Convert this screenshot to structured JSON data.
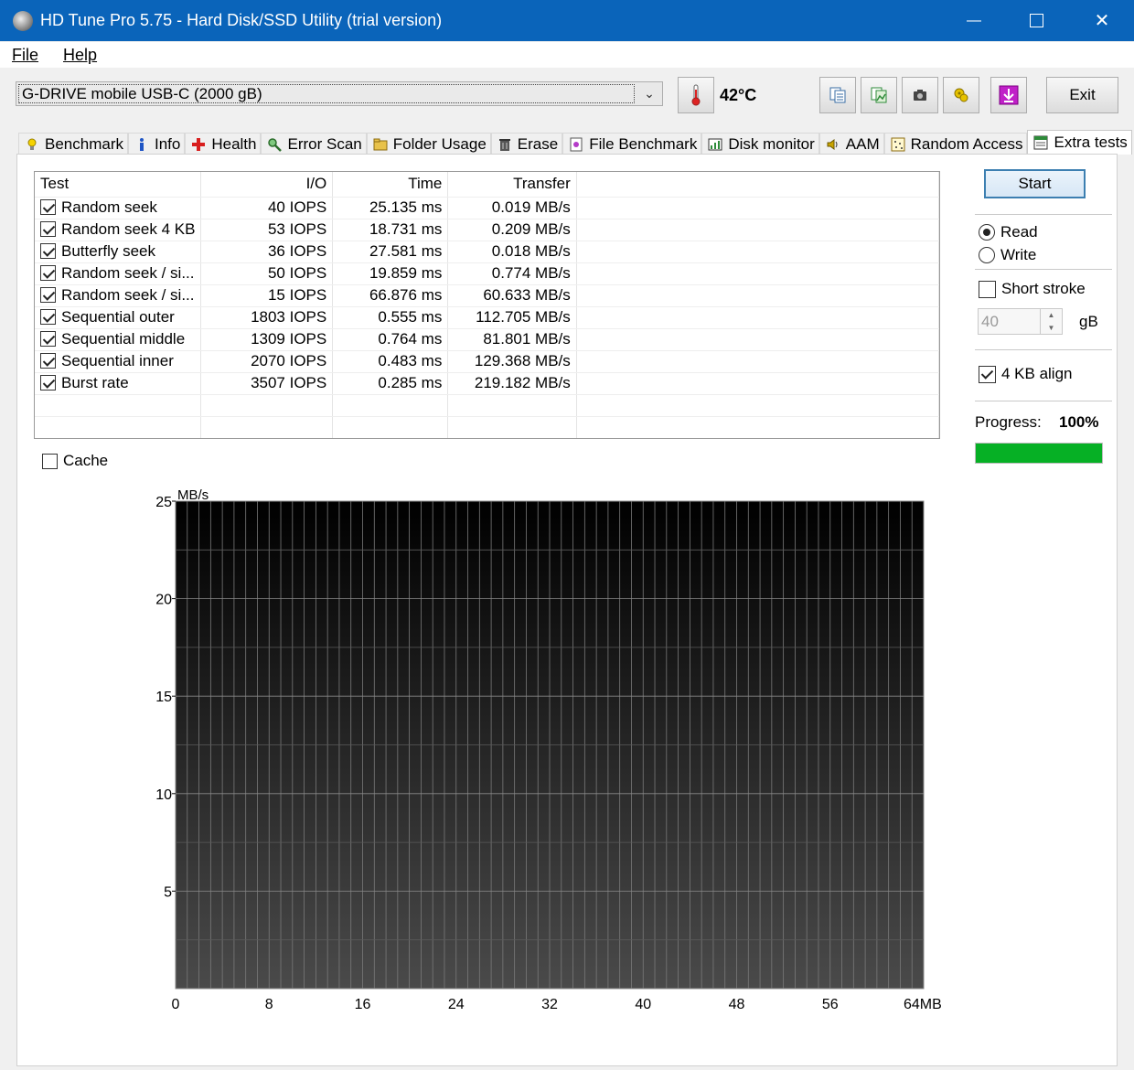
{
  "window": {
    "title": "HD Tune Pro 5.75 - Hard Disk/SSD Utility (trial version)",
    "minimize": "—",
    "close": "✕"
  },
  "menu": [
    "File",
    "Help"
  ],
  "toolbar": {
    "drive": "G-DRIVE mobile USB-C (2000 gB)",
    "temperature": "42°C",
    "exit_label": "Exit",
    "icons": [
      "thermometer-icon",
      "copy-text-icon",
      "copy-image-icon",
      "camera-icon",
      "settings-icon",
      "download-icon"
    ]
  },
  "tabs": [
    {
      "label": "Benchmark",
      "icon": "lightbulb-icon"
    },
    {
      "label": "Info",
      "icon": "info-icon"
    },
    {
      "label": "Health",
      "icon": "health-cross-icon"
    },
    {
      "label": "Error Scan",
      "icon": "magnifier-icon"
    },
    {
      "label": "Folder Usage",
      "icon": "folder-icon"
    },
    {
      "label": "Erase",
      "icon": "trash-icon"
    },
    {
      "label": "File Benchmark",
      "icon": "file-benchmark-icon"
    },
    {
      "label": "Disk monitor",
      "icon": "monitor-chart-icon"
    },
    {
      "label": "AAM",
      "icon": "speaker-icon"
    },
    {
      "label": "Random Access",
      "icon": "random-access-icon"
    },
    {
      "label": "Extra tests",
      "icon": "extra-tests-icon",
      "active": true
    }
  ],
  "results": {
    "headers": [
      "Test",
      "I/O",
      "Time",
      "Transfer"
    ],
    "rows": [
      {
        "test": "Random seek",
        "io": "40 IOPS",
        "time": "25.135 ms",
        "transfer": "0.019 MB/s",
        "checked": true
      },
      {
        "test": "Random seek 4 KB",
        "io": "53 IOPS",
        "time": "18.731 ms",
        "transfer": "0.209 MB/s",
        "checked": true
      },
      {
        "test": "Butterfly seek",
        "io": "36 IOPS",
        "time": "27.581 ms",
        "transfer": "0.018 MB/s",
        "checked": true
      },
      {
        "test": "Random seek / si...",
        "io": "50 IOPS",
        "time": "19.859 ms",
        "transfer": "0.774 MB/s",
        "checked": true
      },
      {
        "test": "Random seek / si...",
        "io": "15 IOPS",
        "time": "66.876 ms",
        "transfer": "60.633 MB/s",
        "checked": true
      },
      {
        "test": "Sequential outer",
        "io": "1803 IOPS",
        "time": "0.555 ms",
        "transfer": "112.705 MB/s",
        "checked": true
      },
      {
        "test": "Sequential middle",
        "io": "1309 IOPS",
        "time": "0.764 ms",
        "transfer": "81.801 MB/s",
        "checked": true
      },
      {
        "test": "Sequential inner",
        "io": "2070 IOPS",
        "time": "0.483 ms",
        "transfer": "129.368 MB/s",
        "checked": true
      },
      {
        "test": "Burst rate",
        "io": "3507 IOPS",
        "time": "0.285 ms",
        "transfer": "219.182 MB/s",
        "checked": true
      }
    ]
  },
  "options": {
    "cache_label": "Cache",
    "cache_checked": false,
    "start_label": "Start",
    "read_label": "Read",
    "write_label": "Write",
    "mode": "Read",
    "short_stroke_label": "Short stroke",
    "short_stroke_checked": false,
    "short_stroke_value": "40",
    "unit": "gB",
    "align_label": "4 KB align",
    "align_checked": true,
    "progress_label": "Progress:",
    "progress_text": "100%",
    "progress": 1.0,
    "progress_color": "#06b025"
  },
  "chart_data": {
    "type": "line",
    "ylabel": "MB/s",
    "ylim": [
      0,
      25
    ],
    "yticks": [
      "5",
      "10",
      "15",
      "20",
      "25"
    ],
    "xlim": [
      0,
      64
    ],
    "xticks": [
      "0",
      "8",
      "16",
      "24",
      "32",
      "40",
      "48",
      "56",
      "64MB"
    ],
    "series": [],
    "grid": true
  }
}
